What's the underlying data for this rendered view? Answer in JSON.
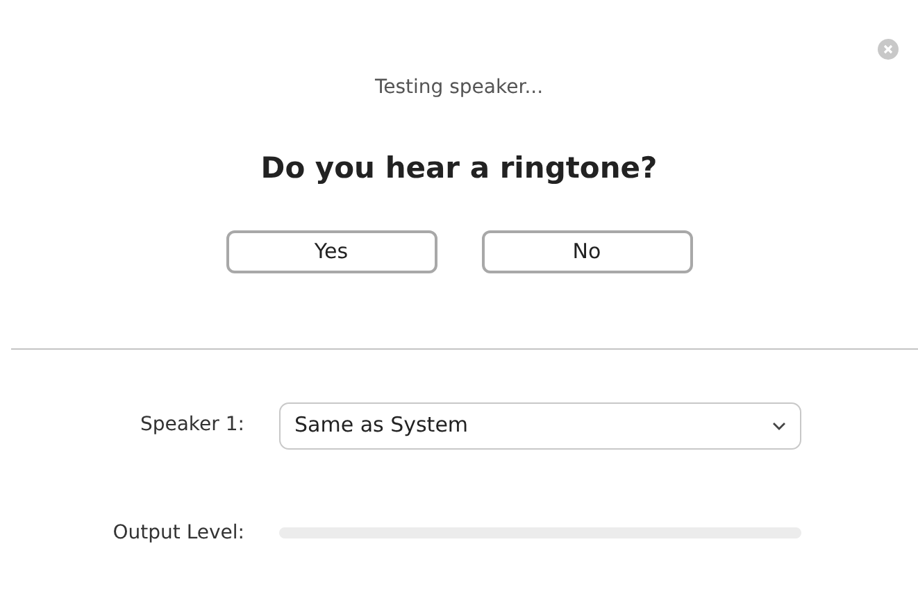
{
  "status": "Testing speaker...",
  "question": "Do you hear a ringtone?",
  "buttons": [
    "Yes",
    "No"
  ],
  "speaker": {
    "label": "Speaker 1:",
    "value": "Same as System"
  },
  "output": {
    "label": "Output Level:",
    "level": 0
  }
}
